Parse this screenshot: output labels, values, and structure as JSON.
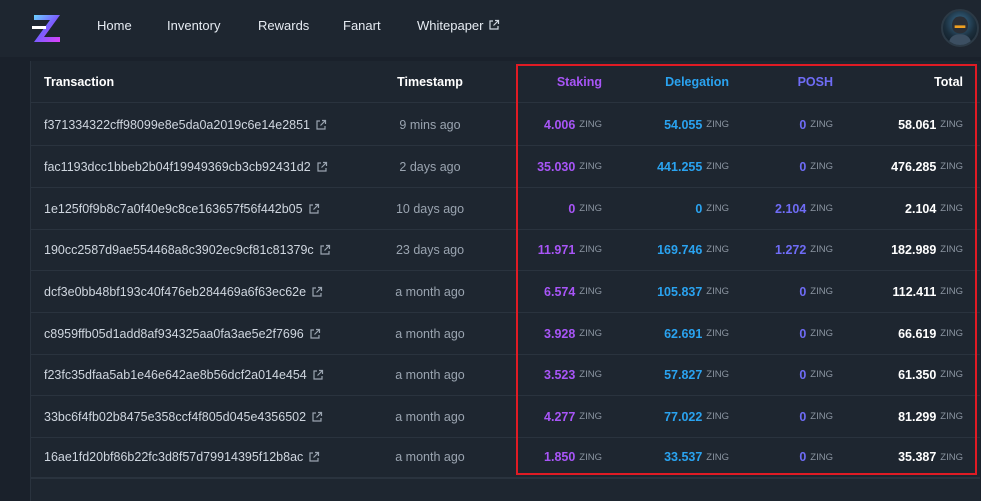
{
  "nav": {
    "items": [
      {
        "label": "Home"
      },
      {
        "label": "Inventory"
      },
      {
        "label": "Rewards"
      },
      {
        "label": "Fanart"
      },
      {
        "label": "Whitepaper"
      }
    ]
  },
  "table": {
    "headers": {
      "transaction": "Transaction",
      "timestamp": "Timestamp",
      "staking": "Staking",
      "delegation": "Delegation",
      "posh": "POSH",
      "total": "Total"
    },
    "unit": "ZING",
    "rows": [
      {
        "tx": "f371334322cff98099e8e5da0a2019c6e14e2851",
        "time": "9 mins ago",
        "staking": "4.006",
        "delegation": "54.055",
        "posh": "0",
        "total": "58.061"
      },
      {
        "tx": "fac1193dcc1bbeb2b04f19949369cb3cb92431d2",
        "time": "2 days ago",
        "staking": "35.030",
        "delegation": "441.255",
        "posh": "0",
        "total": "476.285"
      },
      {
        "tx": "1e125f0f9b8c7a0f40e9c8ce163657f56f442b05",
        "time": "10 days ago",
        "staking": "0",
        "delegation": "0",
        "posh": "2.104",
        "total": "2.104"
      },
      {
        "tx": "190cc2587d9ae554468a8c3902ec9cf81c81379c",
        "time": "23 days ago",
        "staking": "11.971",
        "delegation": "169.746",
        "posh": "1.272",
        "total": "182.989"
      },
      {
        "tx": "dcf3e0bb48bf193c40f476eb284469a6f63ec62e",
        "time": "a month ago",
        "staking": "6.574",
        "delegation": "105.837",
        "posh": "0",
        "total": "112.411"
      },
      {
        "tx": "c8959ffb05d1add8af934325aa0fa3ae5e2f7696",
        "time": "a month ago",
        "staking": "3.928",
        "delegation": "62.691",
        "posh": "0",
        "total": "66.619"
      },
      {
        "tx": "f23fc35dfaa5ab1e46e642ae8b56dcf2a014e454",
        "time": "a month ago",
        "staking": "3.523",
        "delegation": "57.827",
        "posh": "0",
        "total": "61.350"
      },
      {
        "tx": "33bc6f4fb02b8475e358ccf4f805d045e4356502",
        "time": "a month ago",
        "staking": "4.277",
        "delegation": "77.022",
        "posh": "0",
        "total": "81.299"
      },
      {
        "tx": "16ae1fd20bf86b22fc3d8f57d79914395f12b8ac",
        "time": "a month ago",
        "staking": "1.850",
        "delegation": "33.537",
        "posh": "0",
        "total": "35.387"
      }
    ]
  },
  "colors": {
    "staking": "#a855f7",
    "delegation": "#2aa3f0",
    "posh": "#6f6cf6",
    "total": "#ffffff",
    "highlight": "#e01b24"
  },
  "icons": {
    "logo": "z-logo-icon",
    "external": "external-link-icon",
    "avatar": "user-avatar"
  }
}
